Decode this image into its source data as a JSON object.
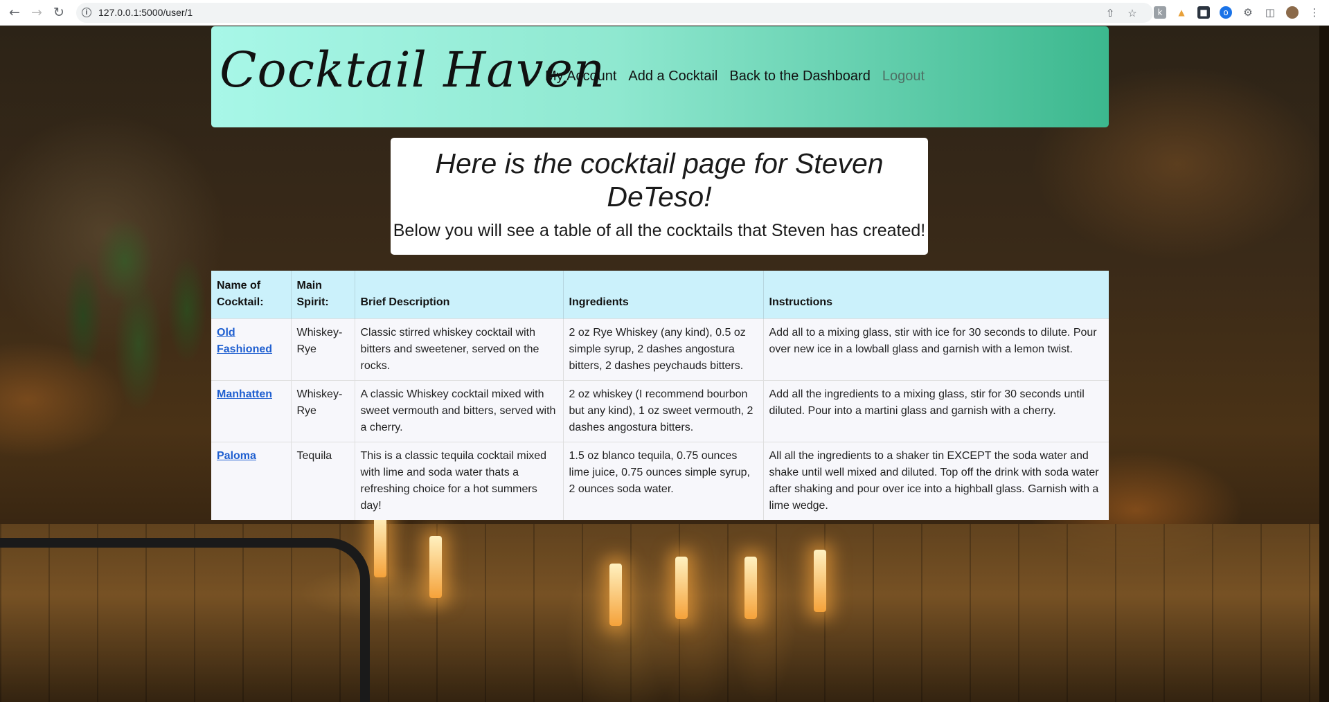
{
  "browser": {
    "url": "127.0.0.1:5000/user/1",
    "back_icon": "arrow-left-icon",
    "forward_icon": "arrow-right-icon",
    "reload_icon": "reload-icon"
  },
  "navbar": {
    "brand": "Cocktail Haven",
    "links": {
      "my_account": "My Account",
      "add_cocktail": "Add a Cocktail",
      "dashboard": "Back to the Dashboard",
      "logout": "Logout"
    },
    "gradient_start": "#a8f7e8",
    "gradient_end": "#3cb88e"
  },
  "hero": {
    "title": "Here is the cocktail page for Steven DeTeso!",
    "subtitle": "Below you will see a table of all the cocktails that Steven has created!"
  },
  "table": {
    "headers": {
      "name": "Name of Cocktail:",
      "spirit": "Main Spirit:",
      "description": "Brief Description",
      "ingredients": "Ingredients",
      "instructions": "Instructions"
    },
    "header_color": "#cbf1fb",
    "link_color": "#1f5fd0",
    "rows": [
      {
        "name": "Old Fashioned",
        "spirit": "Whiskey-Rye",
        "description": "Classic stirred whiskey cocktail with bitters and sweetener, served on the rocks.",
        "ingredients": "2 oz Rye Whiskey (any kind), 0.5 oz simple syrup, 2 dashes angostura bitters, 2 dashes peychauds bitters.",
        "instructions": "Add all to a mixing glass, stir with ice for 30 seconds to dilute. Pour over new ice in a lowball glass and garnish with a lemon twist."
      },
      {
        "name": "Manhatten",
        "spirit": "Whiskey-Rye",
        "description": "A classic Whiskey cocktail mixed with sweet vermouth and bitters, served with a cherry.",
        "ingredients": "2 oz whiskey (I recommend bourbon but any kind), 1 oz sweet vermouth, 2 dashes angostura bitters.",
        "instructions": "Add all the ingredients to a mixing glass, stir for 30 seconds until diluted. Pour into a martini glass and garnish with a cherry."
      },
      {
        "name": "Paloma",
        "spirit": "Tequila",
        "description": "This is a classic tequila cocktail mixed with lime and soda water thats a refreshing choice for a hot summers day!",
        "ingredients": "1.5 oz blanco tequila, 0.75 ounces lime juice, 0.75 ounces simple syrup, 2 ounces soda water.",
        "instructions": "All all the ingredients to a shaker tin EXCEPT the soda water and shake until well mixed and diluted. Top off the drink with soda water after shaking and pour over ice into a highball glass. Garnish with a lime wedge."
      }
    ]
  }
}
